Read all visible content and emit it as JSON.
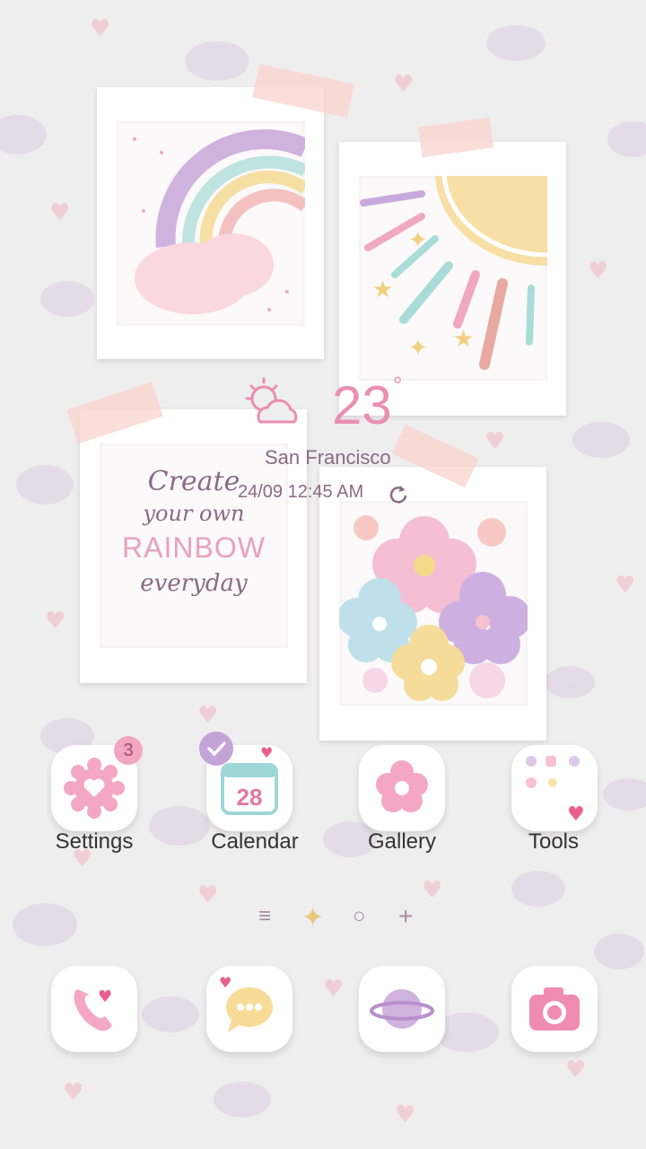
{
  "weather": {
    "temperature": "23",
    "degree_symbol": "°",
    "city": "San Francisco",
    "datetime": "24/09 12:45 AM",
    "icon": "sun-cloud-icon"
  },
  "polaroids": {
    "rainbow": {
      "icon": "rainbow-illustration"
    },
    "sun": {
      "icon": "sun-illustration"
    },
    "quote": {
      "line1": "Create",
      "line2": "your own",
      "line3": "RAINBOW",
      "line4": "everyday"
    },
    "flowers": {
      "icon": "flowers-illustration"
    }
  },
  "apps": [
    {
      "label": "Settings",
      "icon": "gear-icon",
      "badge": "3"
    },
    {
      "label": "Calendar",
      "icon": "calendar-icon",
      "date": "28"
    },
    {
      "label": "Gallery",
      "icon": "flower-icon"
    },
    {
      "label": "Tools",
      "icon": "folder-icon"
    }
  ],
  "page_indicator": [
    "≡",
    "✦",
    "○",
    "+"
  ],
  "dock": [
    {
      "icon": "phone-icon"
    },
    {
      "icon": "messages-icon"
    },
    {
      "icon": "internet-planet-icon"
    },
    {
      "icon": "camera-icon"
    }
  ],
  "colors": {
    "background": "#efeeee",
    "accent_pink": "#e98fb0",
    "accent_purple": "#c4a3d7",
    "text_purple": "#8a6a86"
  }
}
